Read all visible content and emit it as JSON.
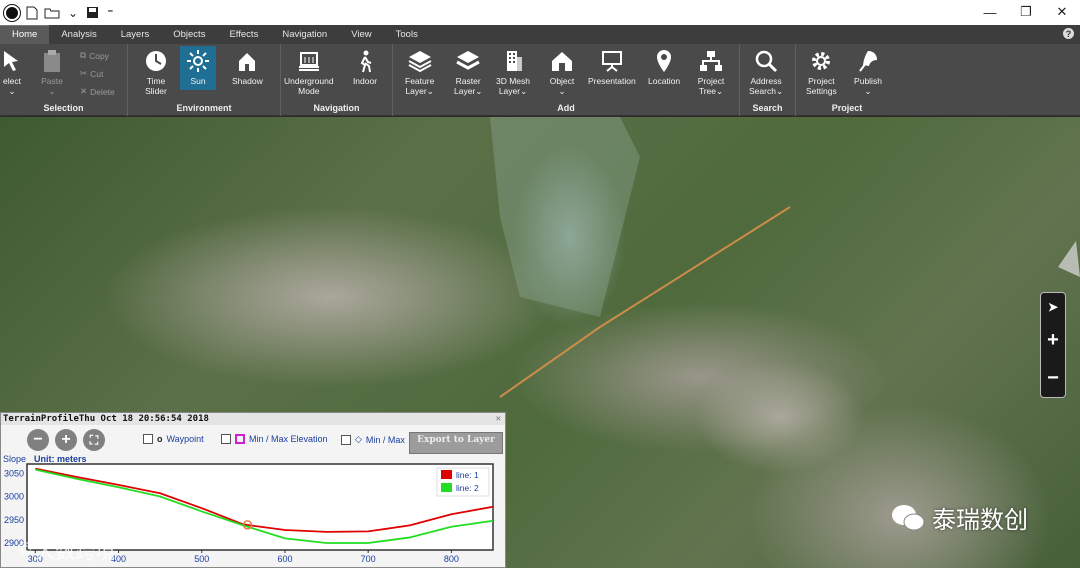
{
  "titlebar": {
    "qat_items": [
      "new-file-icon",
      "open-folder-icon",
      "save-icon"
    ],
    "controls": [
      "minimize",
      "restore",
      "close"
    ]
  },
  "tabs": [
    "Home",
    "Analysis",
    "Layers",
    "Objects",
    "Effects",
    "Navigation",
    "View",
    "Tools"
  ],
  "active_tab": "Home",
  "ribbon": {
    "selection": {
      "label": "Selection",
      "select": "elect",
      "paste": "Paste",
      "copy": "Copy",
      "cut": "Cut",
      "delete": "Delete"
    },
    "environment": {
      "label": "Environment",
      "time_slider_1": "Time",
      "time_slider_2": "Slider",
      "sun": "Sun",
      "shadow": "Shadow"
    },
    "navigation": {
      "label": "Navigation",
      "underground_1": "Underground",
      "underground_2": "Mode",
      "indoor": "Indoor"
    },
    "add": {
      "label": "Add",
      "feature_1": "Feature",
      "feature_2": "Layer",
      "raster_1": "Raster",
      "raster_2": "Layer",
      "mesh_1": "3D Mesh",
      "mesh_2": "Layer",
      "object": "Object",
      "presentation": "Presentation",
      "location": "Location",
      "tree_1": "Project",
      "tree_2": "Tree"
    },
    "search": {
      "label": "Search",
      "address_1": "Address",
      "address_2": "Search"
    },
    "project": {
      "label": "Project",
      "settings_1": "Project",
      "settings_2": "Settings",
      "publish": "Publish"
    }
  },
  "watermark": {
    "brand": "泰瑞数创",
    "bottom": "大数跨境"
  },
  "panel": {
    "title": "TerrainProfileThu Oct 18 20:56:54 2018",
    "waypoint": "Waypoint",
    "minmax_elev": "Min / Max Elevation",
    "minmax": "Min / Max",
    "export": "Export to Layer",
    "slope": "Slope",
    "unit": "Unit: meters"
  },
  "chart_data": {
    "type": "line",
    "series": [
      {
        "name": "line: 1",
        "color": "#e00000",
        "x": [
          300,
          350,
          400,
          450,
          500,
          550,
          600,
          650,
          700,
          750,
          800,
          850
        ],
        "y": [
          3060,
          3042,
          3025,
          3007,
          2975,
          2940,
          2928,
          2924,
          2925,
          2938,
          2962,
          2978
        ]
      },
      {
        "name": "line: 2",
        "color": "#22dd22",
        "x": [
          300,
          350,
          400,
          450,
          500,
          550,
          600,
          650,
          700,
          750,
          800,
          850
        ],
        "y": [
          3058,
          3038,
          3020,
          3000,
          2968,
          2938,
          2910,
          2900,
          2900,
          2912,
          2935,
          2948
        ]
      }
    ],
    "x_ticks": [
      300,
      400,
      500,
      600,
      700,
      800
    ],
    "y_ticks": [
      2900,
      2950,
      3000,
      3050
    ],
    "xlim": [
      290,
      850
    ],
    "ylim": [
      2885,
      3070
    ],
    "waypoint_marker": {
      "x": 555,
      "y": 2939
    }
  }
}
